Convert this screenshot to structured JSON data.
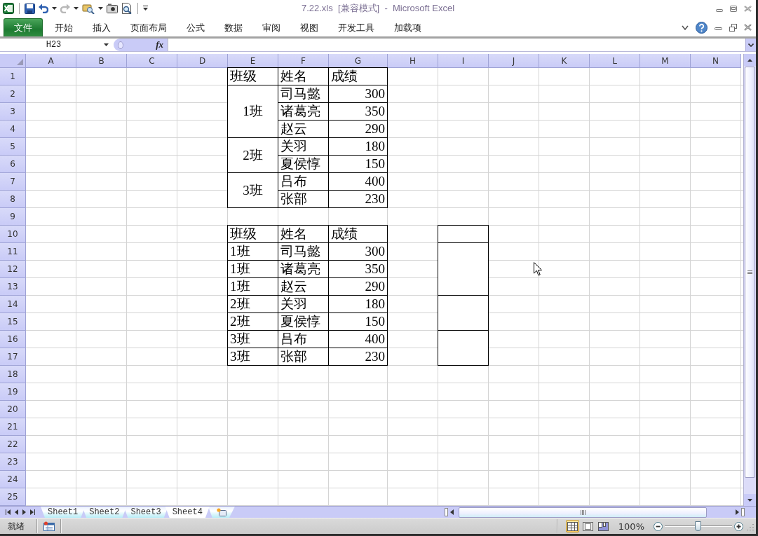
{
  "title_bar": {
    "title": "7.22.xls  [兼容模式]  -  Microsoft Excel"
  },
  "ribbon": {
    "file_tab": "文件",
    "tabs": [
      {
        "label": "开始",
        "selected": false
      },
      {
        "label": "插入",
        "selected": false
      },
      {
        "label": "页面布局",
        "selected": false
      },
      {
        "label": "公式",
        "selected": false
      },
      {
        "label": "数据",
        "selected": false
      },
      {
        "label": "审阅",
        "selected": false
      },
      {
        "label": "视图",
        "selected": false
      },
      {
        "label": "开发工具",
        "selected": false
      },
      {
        "label": "加载项",
        "selected": false
      }
    ]
  },
  "formula_bar": {
    "name_box": "H23",
    "function_button": "fx"
  },
  "sheet": {
    "columns": [
      "A",
      "B",
      "C",
      "D",
      "E",
      "F",
      "G",
      "H",
      "I",
      "J",
      "K",
      "L",
      "M",
      "N"
    ],
    "rows": [
      "1",
      "2",
      "3",
      "4",
      "5",
      "6",
      "7",
      "8",
      "9",
      "10",
      "11",
      "12",
      "13",
      "14",
      "15",
      "16",
      "17",
      "18",
      "19",
      "20",
      "21",
      "22",
      "23",
      "24",
      "25"
    ],
    "grouped_table": {
      "header": [
        "班级",
        "姓名",
        "成绩"
      ],
      "groups": [
        {
          "class": "1班",
          "members": [
            {
              "name": "司马懿",
              "score": "300"
            },
            {
              "name": "诸葛亮",
              "score": "350"
            },
            {
              "name": "赵云",
              "score": "290"
            }
          ]
        },
        {
          "class": "2班",
          "members": [
            {
              "name": "关羽",
              "score": "180"
            },
            {
              "name": "夏侯惇",
              "score": "150"
            }
          ]
        },
        {
          "class": "3班",
          "members": [
            {
              "name": "吕布",
              "score": "400"
            },
            {
              "name": "张部",
              "score": "230"
            }
          ]
        }
      ]
    },
    "flat_table": {
      "header": [
        "班级",
        "姓名",
        "成绩"
      ],
      "helper_column": true,
      "groups": [
        {
          "rows": [
            {
              "class": "1班",
              "name": "司马懿",
              "score": "300"
            },
            {
              "class": "1班",
              "name": "诸葛亮",
              "score": "350"
            },
            {
              "class": "1班",
              "name": "赵云",
              "score": "290"
            }
          ]
        },
        {
          "rows": [
            {
              "class": "2班",
              "name": "关羽",
              "score": "180"
            },
            {
              "class": "2班",
              "name": "夏侯惇",
              "score": "150"
            }
          ]
        },
        {
          "rows": [
            {
              "class": "3班",
              "name": "吕布",
              "score": "400"
            },
            {
              "class": "3班",
              "name": "张部",
              "score": "230"
            }
          ]
        }
      ]
    }
  },
  "sheet_tabs": [
    {
      "label": "Sheet1",
      "selected": false
    },
    {
      "label": "Sheet2",
      "selected": false
    },
    {
      "label": "Sheet3",
      "selected": false
    },
    {
      "label": "Sheet4",
      "selected": true
    }
  ],
  "status_bar": {
    "status": "就绪",
    "view_buttons": [
      {
        "kind": "normal",
        "selected": true
      },
      {
        "kind": "page_layout",
        "selected": false
      },
      {
        "kind": "page_break",
        "selected": false
      }
    ],
    "zoom": {
      "reading": "100%",
      "level": 0.5
    }
  }
}
